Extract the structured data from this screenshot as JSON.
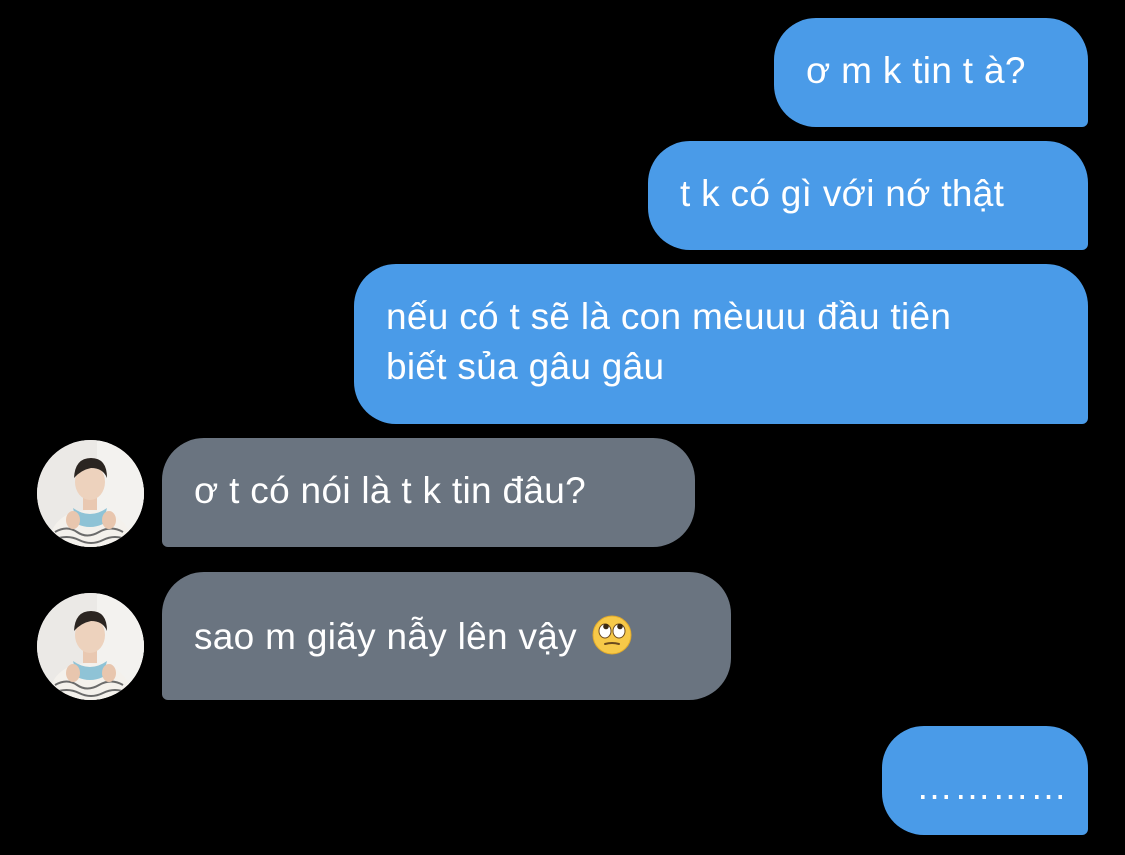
{
  "conversation": {
    "messages": [
      {
        "sender": "me",
        "text": "ơ m k tin t à?"
      },
      {
        "sender": "me",
        "text": "t k có gì với nớ thật"
      },
      {
        "sender": "me",
        "lines": [
          "nếu có t sẽ là con mèuuu đầu tiên",
          "biết sủa gâu gâu"
        ]
      },
      {
        "sender": "friend",
        "text": "ơ t có nói là t k tin đâu?",
        "avatar_icon": "user-avatar"
      },
      {
        "sender": "friend",
        "text": "sao m giãy nẫy lên vậy",
        "emoji": "eye-roll-emoji",
        "avatar_icon": "user-avatar"
      },
      {
        "sender": "me",
        "text": "…………"
      }
    ]
  },
  "colors": {
    "background": "#000000",
    "sent_bubble": "#4a9be8",
    "received_bubble": "#6a7480",
    "text": "#ffffff"
  }
}
